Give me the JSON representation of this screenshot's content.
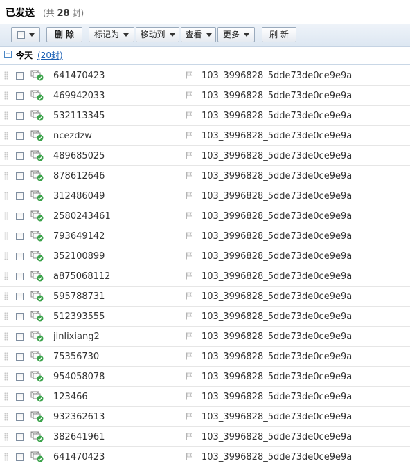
{
  "header": {
    "title": "已发送",
    "count_prefix": "(共",
    "count": "28",
    "count_suffix": "封)"
  },
  "toolbar": {
    "delete_label": "删 除",
    "mark_as_label": "标记为",
    "move_to_label": "移动到",
    "view_label": "查看",
    "more_label": "更多",
    "refresh_label": "刷 新"
  },
  "section": {
    "label": "今天",
    "count": "(20封)"
  },
  "rows": [
    {
      "sender": "641470423",
      "subject": "103_3996828_5dde73de0ce9e9a"
    },
    {
      "sender": "469942033",
      "subject": "103_3996828_5dde73de0ce9e9a"
    },
    {
      "sender": "532113345",
      "subject": "103_3996828_5dde73de0ce9e9a"
    },
    {
      "sender": "ncezdzw",
      "subject": "103_3996828_5dde73de0ce9e9a"
    },
    {
      "sender": "489685025",
      "subject": "103_3996828_5dde73de0ce9e9a"
    },
    {
      "sender": "878612646",
      "subject": "103_3996828_5dde73de0ce9e9a"
    },
    {
      "sender": "312486049",
      "subject": "103_3996828_5dde73de0ce9e9a"
    },
    {
      "sender": "2580243461",
      "subject": "103_3996828_5dde73de0ce9e9a"
    },
    {
      "sender": "793649142",
      "subject": "103_3996828_5dde73de0ce9e9a"
    },
    {
      "sender": "352100899",
      "subject": "103_3996828_5dde73de0ce9e9a"
    },
    {
      "sender": "a875068112",
      "subject": "103_3996828_5dde73de0ce9e9a"
    },
    {
      "sender": "595788731",
      "subject": "103_3996828_5dde73de0ce9e9a"
    },
    {
      "sender": "512393555",
      "subject": "103_3996828_5dde73de0ce9e9a"
    },
    {
      "sender": "jinlixiang2",
      "subject": "103_3996828_5dde73de0ce9e9a"
    },
    {
      "sender": "75356730",
      "subject": "103_3996828_5dde73de0ce9e9a"
    },
    {
      "sender": "954058078",
      "subject": "103_3996828_5dde73de0ce9e9a"
    },
    {
      "sender": "123466",
      "subject": "103_3996828_5dde73de0ce9e9a"
    },
    {
      "sender": "932362613",
      "subject": "103_3996828_5dde73de0ce9e9a"
    },
    {
      "sender": "382641961",
      "subject": "103_3996828_5dde73de0ce9e9a"
    },
    {
      "sender": "641470423",
      "subject": "103_3996828_5dde73de0ce9e9a"
    }
  ],
  "colors": {
    "accent": "#1a5fb4",
    "toolbar_bg": "#dde7f2",
    "sent_badge": "#3aa34a"
  },
  "icons": {
    "row_status": "sent-mail-icon",
    "row_flag": "flag-icon"
  }
}
